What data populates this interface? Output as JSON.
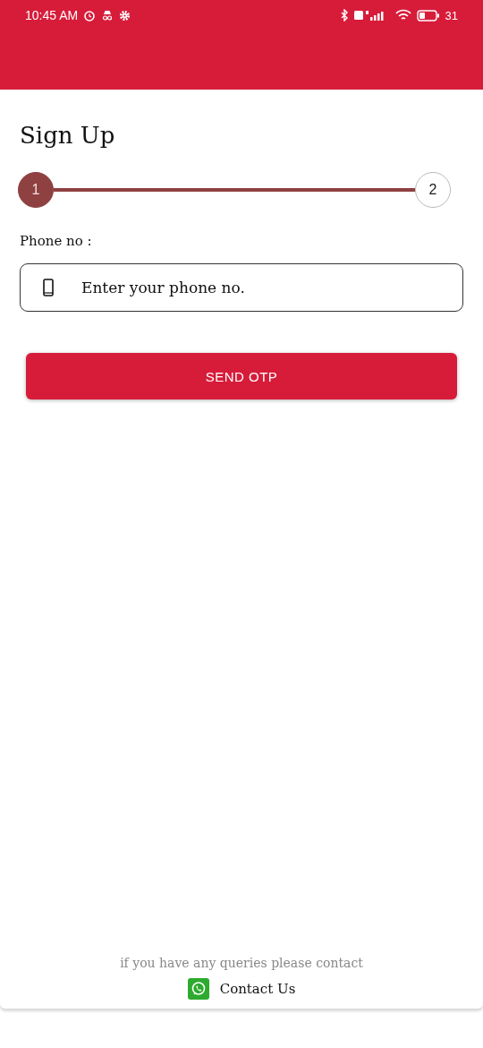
{
  "status_bar": {
    "time": "10:45 AM",
    "battery": "31"
  },
  "title": "Sign Up",
  "steps": [
    {
      "label": "1",
      "selected": true
    },
    {
      "label": "2",
      "selected": false
    }
  ],
  "phone": {
    "label": "Phone no :",
    "placeholder": "Enter your phone no."
  },
  "submit": "SEND OTP",
  "footer": {
    "note": "if you have any queries please contact",
    "link": "Contact Us"
  }
}
